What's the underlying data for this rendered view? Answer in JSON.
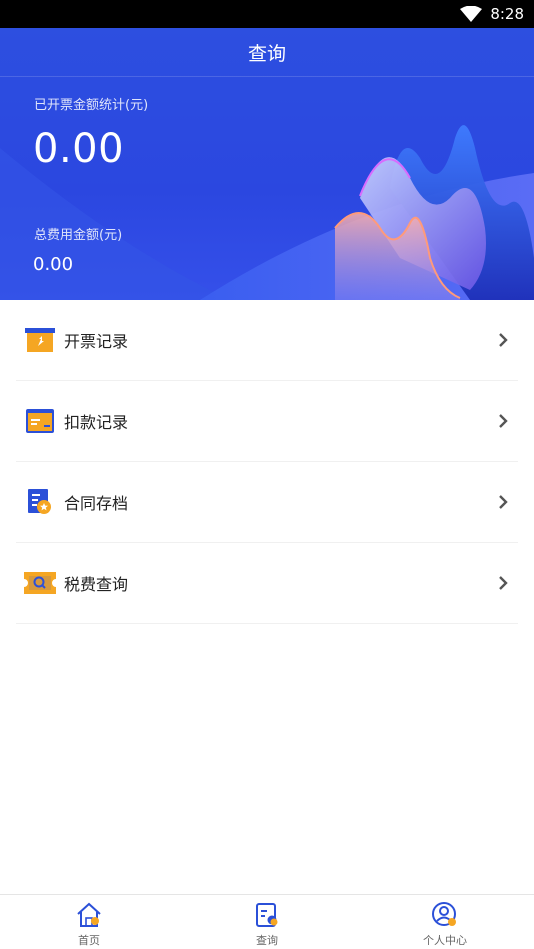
{
  "status_bar": {
    "time": "8:28"
  },
  "header": {
    "title": "查询",
    "invoiced_label": "已开票金额统计(元)",
    "invoiced_value": "0.00",
    "total_fee_label": "总费用金额(元)",
    "total_fee_value": "0.00"
  },
  "menu": [
    {
      "label": "开票记录",
      "icon": "invoice-icon"
    },
    {
      "label": "扣款记录",
      "icon": "card-icon"
    },
    {
      "label": "合同存档",
      "icon": "contract-icon"
    },
    {
      "label": "税费查询",
      "icon": "tax-search-icon"
    }
  ],
  "tabbar": [
    {
      "label": "首页",
      "icon": "home-icon"
    },
    {
      "label": "查询",
      "icon": "query-icon"
    },
    {
      "label": "个人中心",
      "icon": "profile-icon"
    }
  ],
  "colors": {
    "primary": "#2d4fe0",
    "accent": "#f5a623",
    "icon_blue": "#2b50d8"
  }
}
